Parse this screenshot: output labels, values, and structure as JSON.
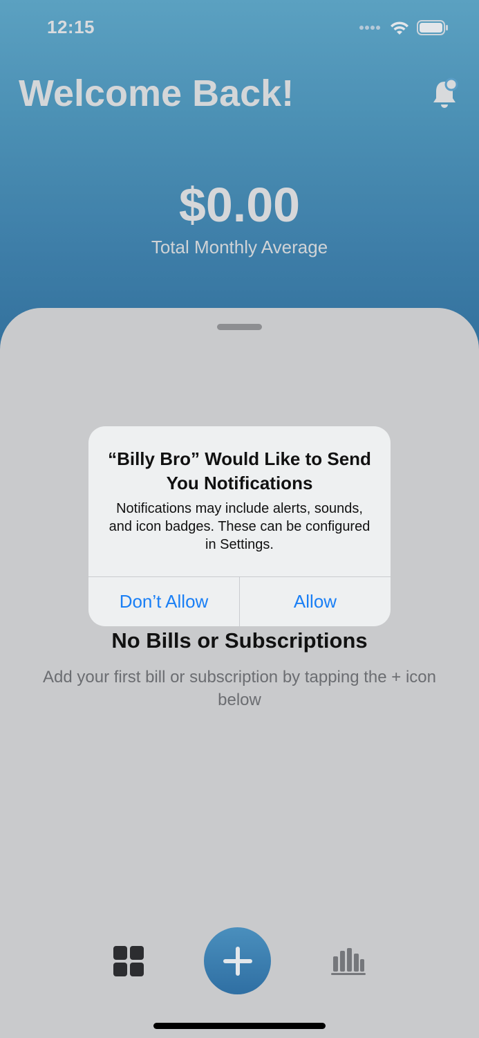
{
  "status_bar": {
    "time": "12:15",
    "icons": [
      "cellular-dots-icon",
      "wifi-icon",
      "battery-icon"
    ]
  },
  "header": {
    "title": "Welcome Back!",
    "notification_icon": "bell-badge-icon",
    "amount": "$0.00",
    "amount_label": "Total Monthly Average"
  },
  "empty_state": {
    "title": "No Bills or Subscriptions",
    "description": "Add your first bill or subscription by tapping the + icon below"
  },
  "tab_bar": {
    "left_icon": "dashboard-grid-icon",
    "center_icon": "plus-icon",
    "right_icon": "bar-chart-icon"
  },
  "alert": {
    "title": "“Billy Bro” Would Like to Send You Notifications",
    "message": "Notifications may include alerts, sounds, and icon badges. These can be configured in Settings.",
    "deny_label": "Don’t Allow",
    "allow_label": "Allow"
  },
  "colors": {
    "header_top": "#5fa8c9",
    "header_bottom": "#3574a3",
    "sheet_bg": "#c9cacc",
    "alert_button": "#1a7ff5",
    "add_button": "#2f6fa3"
  }
}
